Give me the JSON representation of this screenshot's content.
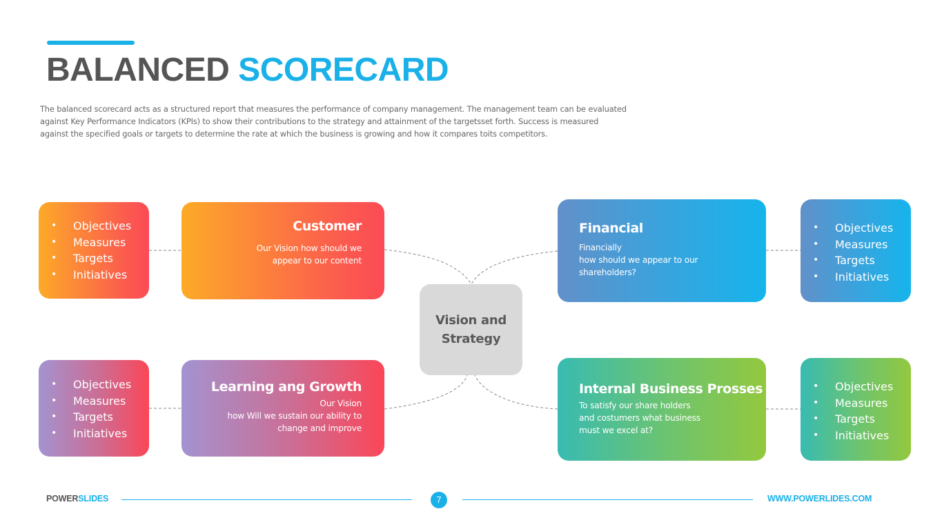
{
  "header": {
    "title_part1": "BALANCED",
    "title_part2": "SCORECARD",
    "description": "The balanced scorecard acts as a structured report that measures the performance of company management. The management team can be evaluated against Key Performance Indicators (KPIs) to show their contributions to the strategy and attainment of the targetsset forth. Success is measured against the specified goals or targets to determine the rate at which the business is growing and how it compares toits competitors."
  },
  "center": {
    "label": "Vision and\nStrategy",
    "color": "#d9d9d9"
  },
  "perspectives": [
    {
      "id": "customer",
      "title": "Customer",
      "text": "Our Vision how should we\nappear to our content",
      "gradient": [
        "#fdaa28",
        "#fb4b55"
      ],
      "list": [
        "Objectives",
        "Measures",
        "Targets",
        "Initiatives"
      ]
    },
    {
      "id": "financial",
      "title": "Financial",
      "text": "Financially\nhow should we appear to our\nshareholders?",
      "gradient": [
        "#6290c9",
        "#16b4ec"
      ],
      "list": [
        "Objectives",
        "Measures",
        "Targets",
        "Initiatives"
      ]
    },
    {
      "id": "learning",
      "title": "Learning ang Growth",
      "text": "Our Vision\nhow Will we sustain our ability to\nchange and improve",
      "gradient": [
        "#a393d0",
        "#fb4657"
      ],
      "list": [
        "Objectives",
        "Measures",
        "Targets",
        "Initiatives"
      ]
    },
    {
      "id": "internal",
      "title": "Internal Business Prosses",
      "text": "To satisfy our share holders\nand costumers what business\nmust we excel at?",
      "gradient": [
        "#38bbb1",
        "#93c83e"
      ],
      "list": [
        "Objectives",
        "Measures",
        "Targets",
        "Initiatives"
      ]
    }
  ],
  "bullet_glyph": "•",
  "footer": {
    "brand_part1": "POWER",
    "brand_part2": "SLIDES",
    "page_number": "7",
    "url": "WWW.POWERLIDES.COM"
  },
  "colors": {
    "accent": "#1ab0e8",
    "title_gray": "#555555"
  }
}
